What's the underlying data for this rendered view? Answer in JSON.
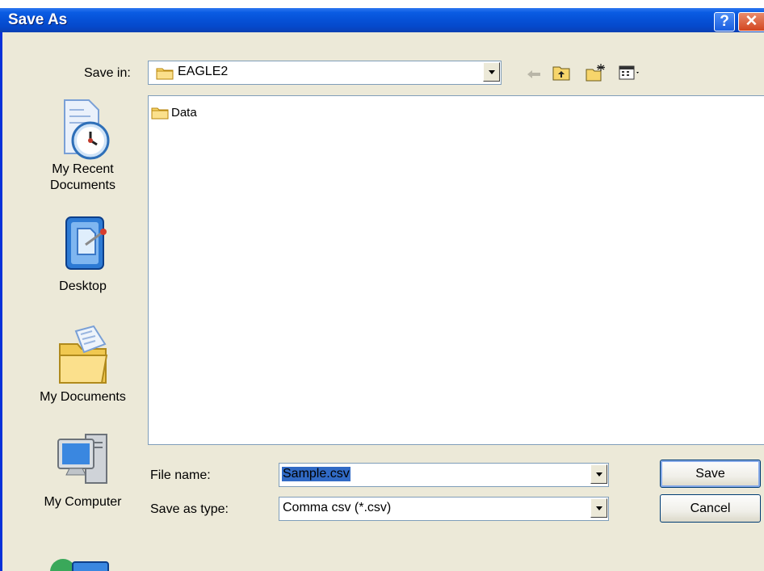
{
  "dialog": {
    "title": "Save As"
  },
  "toolbar": {
    "save_in_label": "Save in:",
    "save_in_value": "EAGLE2"
  },
  "file_list": {
    "items": [
      {
        "name": "Data",
        "icon": "folder-icon"
      }
    ]
  },
  "places": [
    {
      "label_line1": "My Recent",
      "label_line2": "Documents",
      "icon": "recent-documents-icon"
    },
    {
      "label_line1": "Desktop",
      "icon": "desktop-icon"
    },
    {
      "label_line1": "My Documents",
      "icon": "my-documents-icon"
    },
    {
      "label_line1": "My Computer",
      "icon": "my-computer-icon"
    }
  ],
  "form": {
    "file_name_label": "File name:",
    "file_name_value": "Sample.csv",
    "type_label": "Save as type:",
    "type_value": "Comma csv (*.csv)"
  },
  "buttons": {
    "save": "Save",
    "cancel": "Cancel"
  },
  "colors": {
    "titlebar": "#0a5ce3",
    "face": "#ece9d8",
    "selection": "#316ac5"
  }
}
